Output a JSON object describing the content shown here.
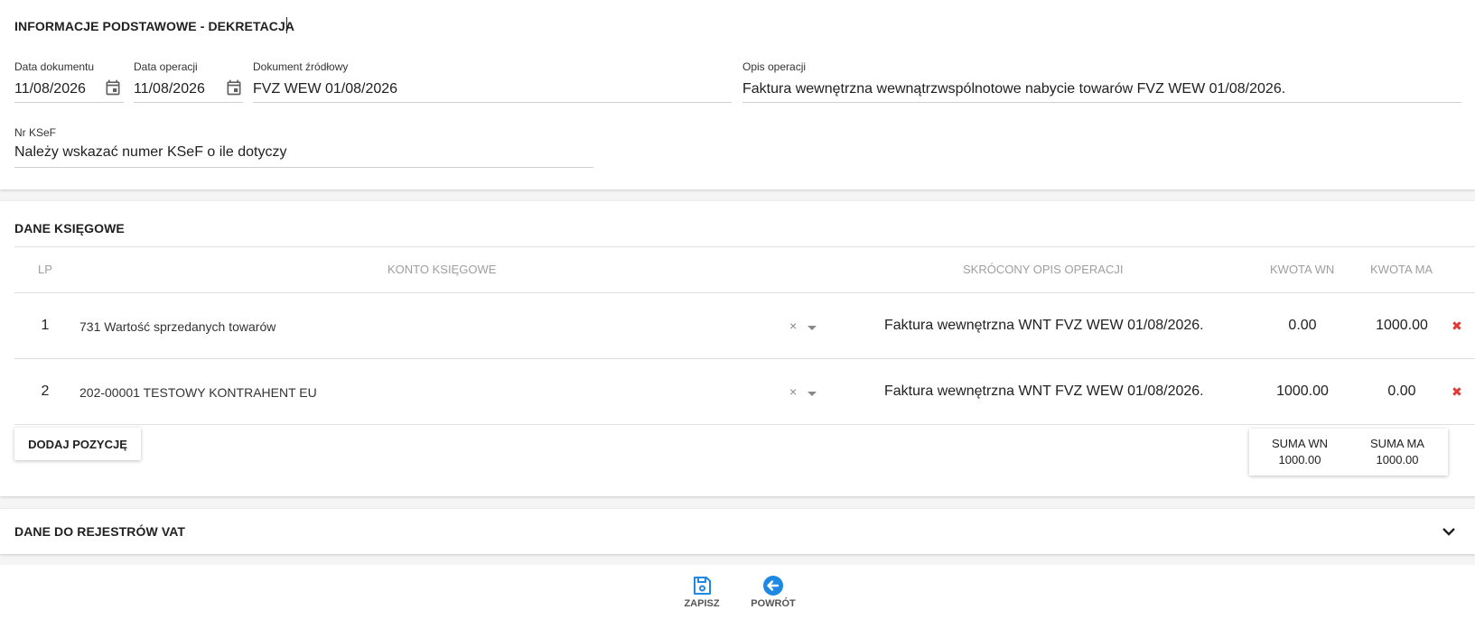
{
  "basic_info": {
    "title": "INFORMACJE PODSTAWOWE - DEKRETACJA",
    "doc_date_label": "Data dokumentu",
    "doc_date_value": "11/08/2026",
    "op_date_label": "Data operacji",
    "op_date_value": "11/08/2026",
    "source_doc_label": "Dokument źródłowy",
    "source_doc_value": "FVZ WEW 01/08/2026",
    "op_desc_label": "Opis operacji",
    "op_desc_value": "Faktura wewnętrzna wewnątrzwspólnotowe nabycie towarów FVZ WEW 01/08/2026.",
    "ksef_label": "Nr KSeF",
    "ksef_value": "Należy wskazać numer KSeF o ile dotyczy"
  },
  "accounting": {
    "title": "DANE KSIĘGOWE",
    "columns": [
      "LP",
      "KONTO KSIĘGOWE",
      "SKRÓCONY OPIS OPERACJI",
      "KWOTA WN",
      "KWOTA MA"
    ],
    "rows": [
      {
        "lp": "1",
        "account": "731 Wartość sprzedanych towarów",
        "clear": "×",
        "desc": "Faktura wewnętrzna WNT FVZ WEW 01/08/2026.",
        "wn": "0.00",
        "ma": "1000.00",
        "delete": "✖"
      },
      {
        "lp": "2",
        "account": "202-00001 TESTOWY KONTRAHENT EU",
        "clear": "×",
        "desc": "Faktura wewnętrzna WNT FVZ WEW 01/08/2026.",
        "wn": "1000.00",
        "ma": "0.00",
        "delete": "✖"
      }
    ],
    "add_button": "DODAJ POZYCJĘ",
    "sum_wn_label": "SUMA WN",
    "sum_wn_value": "1000.00",
    "sum_ma_label": "SUMA MA",
    "sum_ma_value": "1000.00"
  },
  "vat": {
    "title": "DANE DO REJESTRÓW VAT"
  },
  "footer": {
    "save_label": "ZAPISZ",
    "back_label": "POWRÓT"
  },
  "colors": {
    "accent": "#1e88e5",
    "delete": "#e53935"
  },
  "icons": {
    "calendar": "calendar-icon",
    "save": "save-icon",
    "back": "arrow-left-circle-icon",
    "expand": "chevron-down-icon"
  }
}
